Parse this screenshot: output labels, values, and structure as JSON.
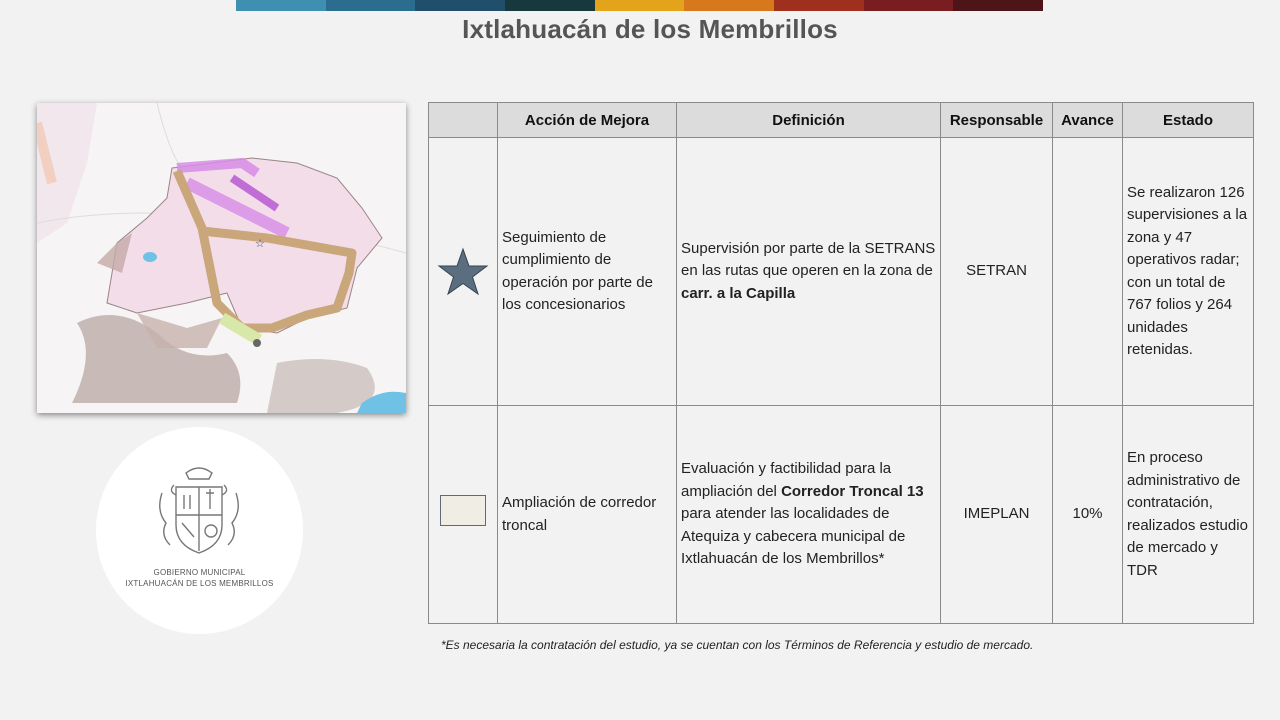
{
  "header": {
    "title": "Ixtlahuacán de los Membrillos",
    "band_colors": [
      "#3e8fb0",
      "#2a6d8f",
      "#1f4f6a",
      "#17383d",
      "#e3a31b",
      "#d8781c",
      "#a0301e",
      "#7a1d21",
      "#4d1518"
    ]
  },
  "map": {
    "icon": "map-image",
    "colors": {
      "municipality": "#f3dde9",
      "road": "#c9a77a",
      "route": "#d68ce6",
      "terrain": "#b8a8a3",
      "water": "#6fc2e6"
    }
  },
  "seal": {
    "icon": "municipal-coat-of-arms-icon",
    "line1": "GOBIERNO MUNICIPAL",
    "line2": "IXTLAHUACÁN DE LOS MEMBRILLOS"
  },
  "table": {
    "headers": [
      "",
      "Acción de Mejora",
      "Definición",
      "Responsable",
      "Avance",
      "Estado"
    ],
    "rows": [
      {
        "icon": "star-icon",
        "accion": "Seguimiento de cumplimiento de operación por parte de los concesionarios",
        "definicion_pre": "Supervisión por parte de la SETRANS en las rutas que operen en la zona de ",
        "definicion_bold": "carr. a la Capilla",
        "definicion_post": "",
        "responsable": "SETRAN",
        "avance": "",
        "estado": "Se realizaron 126 supervisiones a la zona y 47 operativos radar; con un total de 767 folios y 264 unidades retenidas."
      },
      {
        "icon": "legend-swatch-icon",
        "accion": "Ampliación de corredor troncal",
        "definicion_pre": "Evaluación y factibilidad para la ampliación del ",
        "definicion_bold": "Corredor Troncal 13",
        "definicion_post": " para atender las localidades de Atequiza y cabecera municipal de Ixtlahuacán de los Membrillos*",
        "responsable": "IMEPLAN",
        "avance": "10%",
        "estado": "En proceso administrativo de contratación, realizados estudio de mercado y TDR"
      }
    ]
  },
  "footnote": "*Es necesaria la contratación del estudio, ya se cuentan con los Términos de Referencia y estudio de mercado."
}
